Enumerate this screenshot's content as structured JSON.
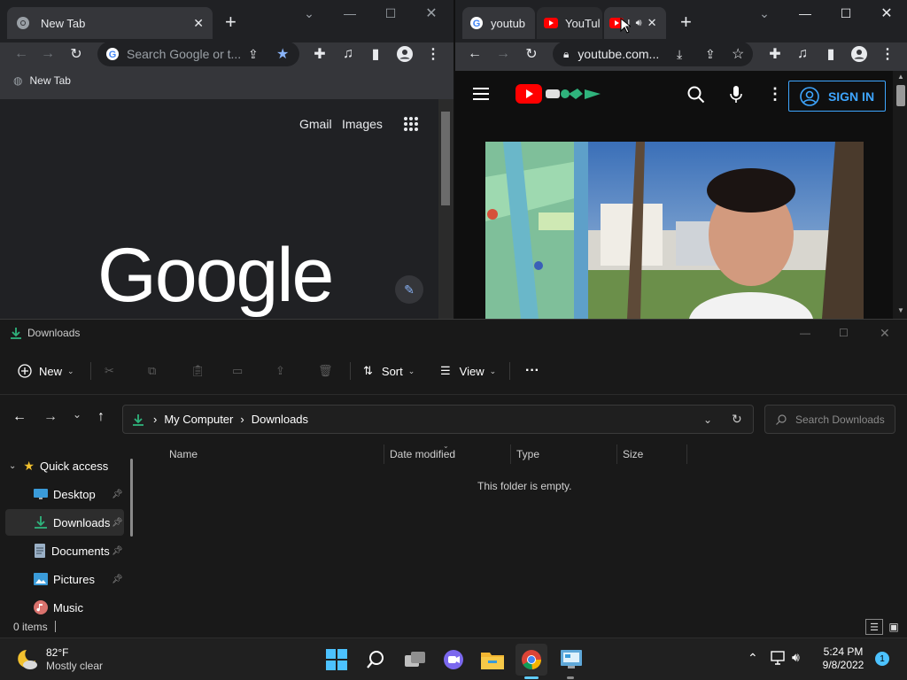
{
  "left_browser": {
    "tab_title": "New Tab",
    "omnibox_placeholder": "Search Google or t...",
    "bookmark_label": "New Tab",
    "gmail_link": "Gmail",
    "images_link": "Images",
    "logo_text": "Google"
  },
  "right_browser": {
    "tabs": [
      {
        "label": "youtub"
      },
      {
        "label": "YouTul"
      },
      {
        "label": "I"
      }
    ],
    "url": "youtube.com...",
    "sign_in_label": "SIGN IN"
  },
  "explorer": {
    "title": "Downloads",
    "new_label": "New",
    "sort_label": "Sort",
    "view_label": "View",
    "more_label": "···",
    "breadcrumb": [
      "My Computer",
      "Downloads"
    ],
    "search_placeholder": "Search Downloads",
    "nav_items": [
      {
        "label": "Quick access",
        "icon": "star-icon"
      },
      {
        "label": "Desktop",
        "icon": "desktop-icon",
        "pinned": true
      },
      {
        "label": "Downloads",
        "icon": "download-icon",
        "pinned": true,
        "selected": true
      },
      {
        "label": "Documents",
        "icon": "documents-icon",
        "pinned": true
      },
      {
        "label": "Pictures",
        "icon": "pictures-icon",
        "pinned": true
      },
      {
        "label": "Music",
        "icon": "music-icon"
      }
    ],
    "columns": [
      "Name",
      "Date modified",
      "Type",
      "Size"
    ],
    "empty_message": "This folder is empty.",
    "status": "0 items"
  },
  "taskbar": {
    "weather_temp": "82°F",
    "weather_desc": "Mostly clear",
    "time": "5:24 PM",
    "date": "9/8/2022",
    "notification_count": "1"
  },
  "colors": {
    "accent_blue": "#3ea6ff",
    "youtube_red": "#ff0000",
    "download_green": "#2fb37c"
  }
}
